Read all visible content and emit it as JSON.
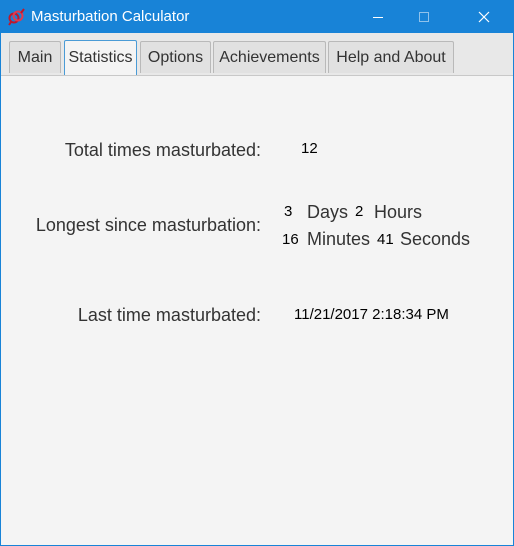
{
  "window": {
    "title": "Masturbation Calculator",
    "icon": "app-logo-icon",
    "title_bar_color": "#1883d7"
  },
  "tabs": [
    {
      "label": "Main",
      "active": false
    },
    {
      "label": "Statistics",
      "active": true
    },
    {
      "label": "Options",
      "active": false
    },
    {
      "label": "Achievements",
      "active": false
    },
    {
      "label": "Help and About",
      "active": false
    }
  ],
  "statistics": {
    "total_label": "Total times masturbated:",
    "total_value": "12",
    "longest_label": "Longest since masturbation:",
    "longest": {
      "days": "3",
      "days_unit": "Days",
      "hours": "2",
      "hours_unit": "Hours",
      "minutes": "16",
      "minutes_unit": "Minutes",
      "seconds": "41",
      "seconds_unit": "Seconds"
    },
    "last_label": "Last time masturbated:",
    "last_value": "11/21/2017 2:18:34 PM"
  }
}
